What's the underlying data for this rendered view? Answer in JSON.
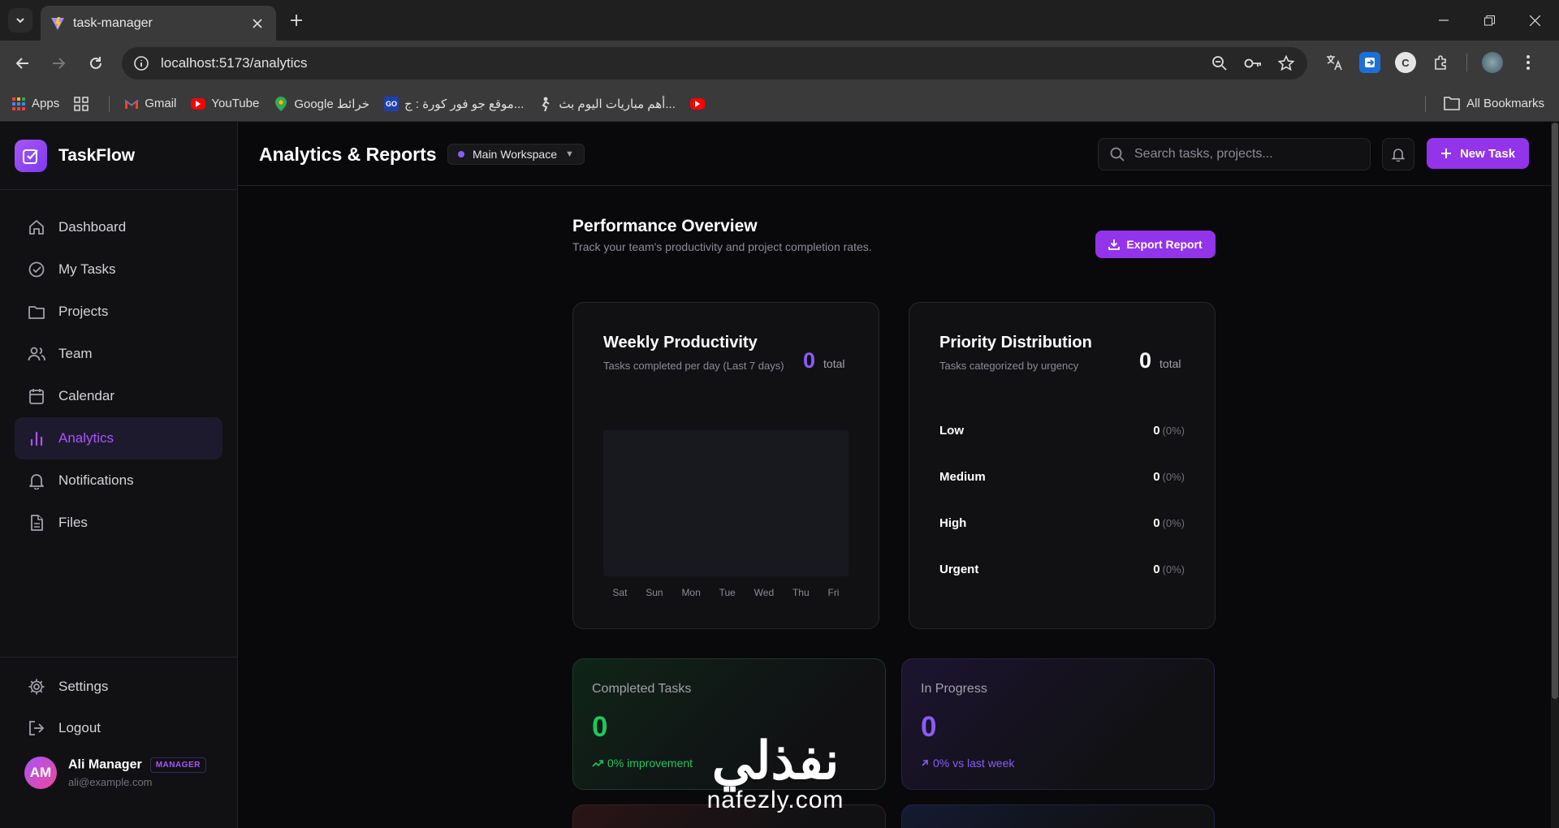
{
  "browser": {
    "tab_title": "task-manager",
    "url": "localhost:5173/analytics",
    "bookmarks": [
      {
        "label": "Apps",
        "icon": "apps-grid-icon"
      },
      {
        "label": "",
        "icon": "grid-icon"
      },
      {
        "label": "Gmail",
        "icon": "gmail-icon"
      },
      {
        "label": "YouTube",
        "icon": "youtube-icon"
      },
      {
        "label": "Google خرائط",
        "icon": "maps-icon"
      },
      {
        "label": "موقع جو فور كورة : ج...",
        "icon": "goforkora-icon"
      },
      {
        "label": "أهم مباريات اليوم بث...",
        "icon": "match-icon"
      },
      {
        "label": "",
        "icon": "youtube-icon"
      }
    ],
    "all_bookmarks": "All Bookmarks"
  },
  "app": {
    "brand": "TaskFlow",
    "nav": [
      {
        "label": "Dashboard",
        "icon": "home-icon",
        "active": false
      },
      {
        "label": "My Tasks",
        "icon": "check-circle-icon",
        "active": false
      },
      {
        "label": "Projects",
        "icon": "folder-icon",
        "active": false
      },
      {
        "label": "Team",
        "icon": "users-icon",
        "active": false
      },
      {
        "label": "Calendar",
        "icon": "calendar-icon",
        "active": false
      },
      {
        "label": "Analytics",
        "icon": "bar-chart-icon",
        "active": true
      },
      {
        "label": "Notifications",
        "icon": "bell-icon",
        "active": false
      },
      {
        "label": "Files",
        "icon": "file-icon",
        "active": false
      }
    ],
    "settings": "Settings",
    "logout": "Logout",
    "user": {
      "initials": "AM",
      "name": "Ali Manager",
      "role": "MANAGER",
      "email": "ali@example.com"
    }
  },
  "header": {
    "title": "Analytics & Reports",
    "workspace": "Main Workspace",
    "search_placeholder": "Search tasks, projects...",
    "new_task": "New Task"
  },
  "overview": {
    "title": "Performance Overview",
    "subtitle": "Track your team's productivity and project completion rates.",
    "export": "Export Report"
  },
  "weekly": {
    "title": "Weekly Productivity",
    "subtitle": "Tasks completed per day (Last 7 days)",
    "total": "0",
    "total_label": "total",
    "days": [
      "Sat",
      "Sun",
      "Mon",
      "Tue",
      "Wed",
      "Thu",
      "Fri"
    ]
  },
  "priority": {
    "title": "Priority Distribution",
    "subtitle": "Tasks categorized by urgency",
    "total": "0",
    "total_label": "total",
    "rows": [
      {
        "name": "Low",
        "value": "0",
        "pct": "(0%)"
      },
      {
        "name": "Medium",
        "value": "0",
        "pct": "(0%)"
      },
      {
        "name": "High",
        "value": "0",
        "pct": "(0%)"
      },
      {
        "name": "Urgent",
        "value": "0",
        "pct": "(0%)"
      }
    ]
  },
  "stats": [
    {
      "label": "Completed Tasks",
      "value": "0",
      "trend": "0% improvement",
      "color": "#22c55e"
    },
    {
      "label": "In Progress",
      "value": "0",
      "trend": "0% vs last week",
      "color": "#8b5cf6"
    }
  ],
  "watermark": {
    "arabic": "نفذلي",
    "latin": "nafezly.com"
  },
  "colors": {
    "accent": "#9333ea",
    "success": "#22c55e",
    "purple": "#8b5cf6"
  }
}
